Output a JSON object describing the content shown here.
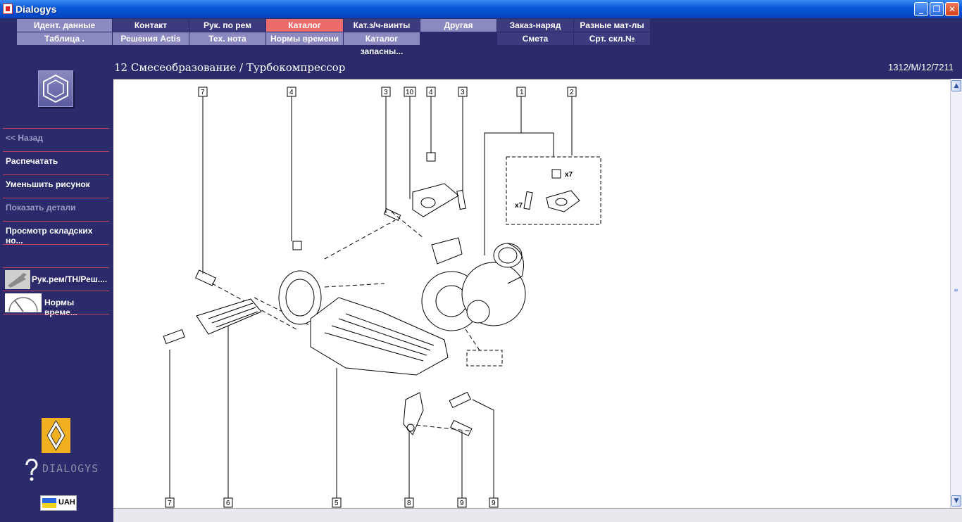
{
  "window": {
    "title": "Dialogys",
    "icon": "dialogys-app-icon"
  },
  "menu": {
    "row1": [
      "Идент. данные",
      "Контакт",
      "Рук. по рем",
      "Каталог запчастей",
      "Кат.з/ч-винты",
      "Другая",
      "Заказ-наряд",
      "Разные мат-лы"
    ],
    "row2": [
      "Таблица .",
      "Решения Actis",
      "Тех. нота",
      "Нормы времени",
      "Каталог запасны...",
      "",
      "Смета",
      "Срт. скл.№"
    ],
    "active": "Каталог запчастей",
    "colors": {
      "light": "#8a8ac0",
      "dark": "#3b3b7e",
      "active": "#ec6c6c"
    }
  },
  "sidebar": {
    "nav": [
      {
        "label": "<< Назад",
        "enabled": false
      },
      {
        "label": "Распечатать",
        "enabled": true
      },
      {
        "label": "Уменьшить рисунок",
        "enabled": true
      },
      {
        "label": "Показать детали",
        "enabled": false
      },
      {
        "label": "Просмотр складских но...",
        "enabled": true
      }
    ],
    "tools": [
      {
        "label": "Рук.рем/ТН/Реш....",
        "icon": "wrench-icon"
      },
      {
        "label": "Нормы време...",
        "icon": "gauge-icon"
      }
    ],
    "logo_text": "DIALOGYS",
    "currency": "UAH"
  },
  "header": {
    "title": "12 Смесеобразование / Турбокомпрессор",
    "code": "1312/M/12/7211"
  },
  "diagram": {
    "top_labels": [
      "7",
      "4",
      "3",
      "10",
      "4",
      "3",
      "1",
      "2"
    ],
    "bottom_labels": [
      "7",
      "6",
      "5",
      "8",
      "9",
      "9"
    ],
    "kit_multipliers": [
      "x7",
      "x7"
    ]
  },
  "colors": {
    "background": "#2b2b6b",
    "separator": "#c04060",
    "titlebar": "#0a5ad8"
  }
}
